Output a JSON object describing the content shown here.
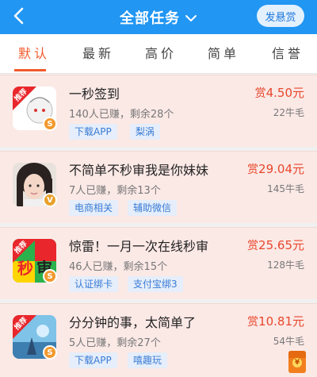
{
  "header": {
    "title": "全部任务",
    "bounty_button": "发悬赏",
    "back_icon": "back-arrow-icon",
    "caret_icon": "chevron-down-icon"
  },
  "tabs": [
    {
      "label": "默认",
      "active": true
    },
    {
      "label": "最新",
      "active": false
    },
    {
      "label": "高价",
      "active": false
    },
    {
      "label": "简单",
      "active": false
    },
    {
      "label": "信誉",
      "active": false
    }
  ],
  "tasks": [
    {
      "title": "一秒签到",
      "subtitle": "140人已赚，剩余28个",
      "reward_prefix": "赏",
      "reward_amount": "4.50元",
      "wool": "22牛毛",
      "tags": [
        "下载APP",
        "梨涡"
      ],
      "icon": "recommend-app-icon",
      "badge": "S"
    },
    {
      "title": "不简单不秒审我是你妹妹",
      "subtitle": "7人已赚，剩余13个",
      "reward_prefix": "赏",
      "reward_amount": "29.04元",
      "wool": "145牛毛",
      "tags": [
        "电商相关",
        "辅助微信"
      ],
      "icon": "user-avatar-icon",
      "badge": "V"
    },
    {
      "title": "惊雷！一月一次在线秒审",
      "subtitle": "46人已赚，剩余15个",
      "reward_prefix": "赏",
      "reward_amount": "25.65元",
      "wool": "128牛毛",
      "tags": [
        "认证绑卡",
        "支付宝绑3"
      ],
      "icon": "recommend-miaoshen-icon",
      "badge": "S"
    },
    {
      "title": "分分钟的事，太简单了",
      "subtitle": "5人已赚，剩余27个",
      "reward_prefix": "赏",
      "reward_amount": "10.81元",
      "wool": "54牛毛",
      "tags": [
        "下载APP",
        "嘻趣玩"
      ],
      "icon": "recommend-app-icon",
      "badge": "S"
    }
  ],
  "icon_texts": {
    "recommend": "推荐",
    "miao": "秒",
    "shen": "审"
  },
  "redpack_symbol": "¥",
  "colors": {
    "header_blue": "#2196f3",
    "active_tab": "#f25a2c",
    "reward_red": "#e8472c",
    "card_bg": "#fbe9e6",
    "tag_bg": "#e5eefa",
    "tag_text": "#3a7bd5"
  }
}
